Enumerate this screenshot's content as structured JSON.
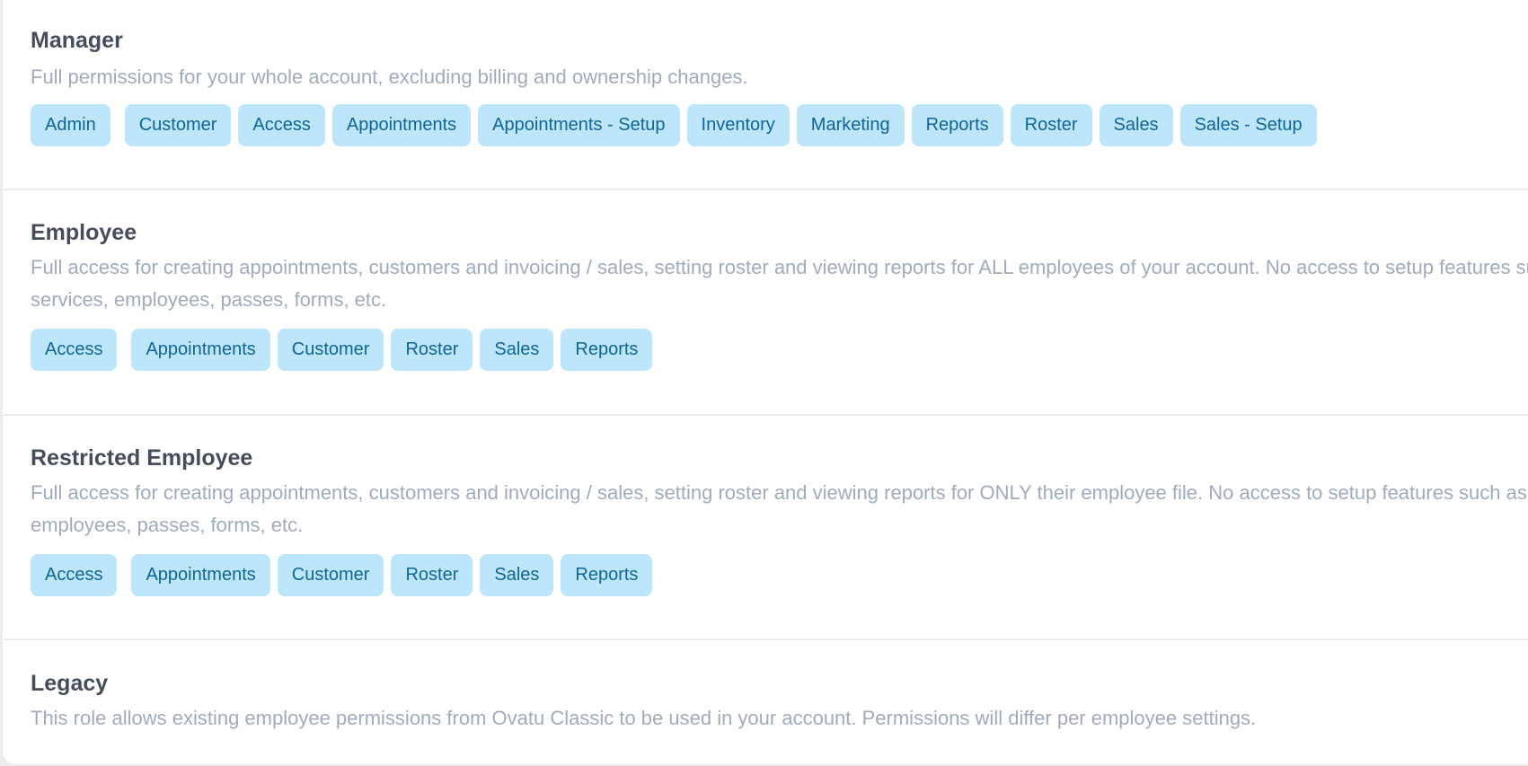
{
  "roles": [
    {
      "title": "Manager",
      "description": "Full permissions for your whole account, excluding billing and ownership changes.",
      "permissions": [
        "Admin",
        "Customer",
        "Access",
        "Appointments",
        "Appointments - Setup",
        "Inventory",
        "Marketing",
        "Reports",
        "Roster",
        "Sales",
        "Sales - Setup"
      ]
    },
    {
      "title": "Employee",
      "description": "Full access for creating appointments, customers and invoicing / sales, setting roster and viewing reports for ALL employees of your account. No access to setup features such as services, employees, passes, forms, etc.",
      "permissions": [
        "Access",
        "Appointments",
        "Customer",
        "Roster",
        "Sales",
        "Reports"
      ]
    },
    {
      "title": "Restricted Employee",
      "description": "Full access for creating appointments, customers and invoicing / sales, setting roster and viewing reports for ONLY their employee file. No access to setup features such as services, employees, passes, forms, etc.",
      "permissions": [
        "Access",
        "Appointments",
        "Customer",
        "Roster",
        "Sales",
        "Reports"
      ]
    },
    {
      "title": "Legacy",
      "description": "This role allows existing employee permissions from Ovatu Classic to be used in your account. Permissions will differ per employee settings.",
      "permissions": []
    }
  ],
  "colors": {
    "pill_bg": "#bde6fb",
    "pill_text": "#0f6597",
    "title": "#454d5d",
    "description": "#a0abbd"
  }
}
